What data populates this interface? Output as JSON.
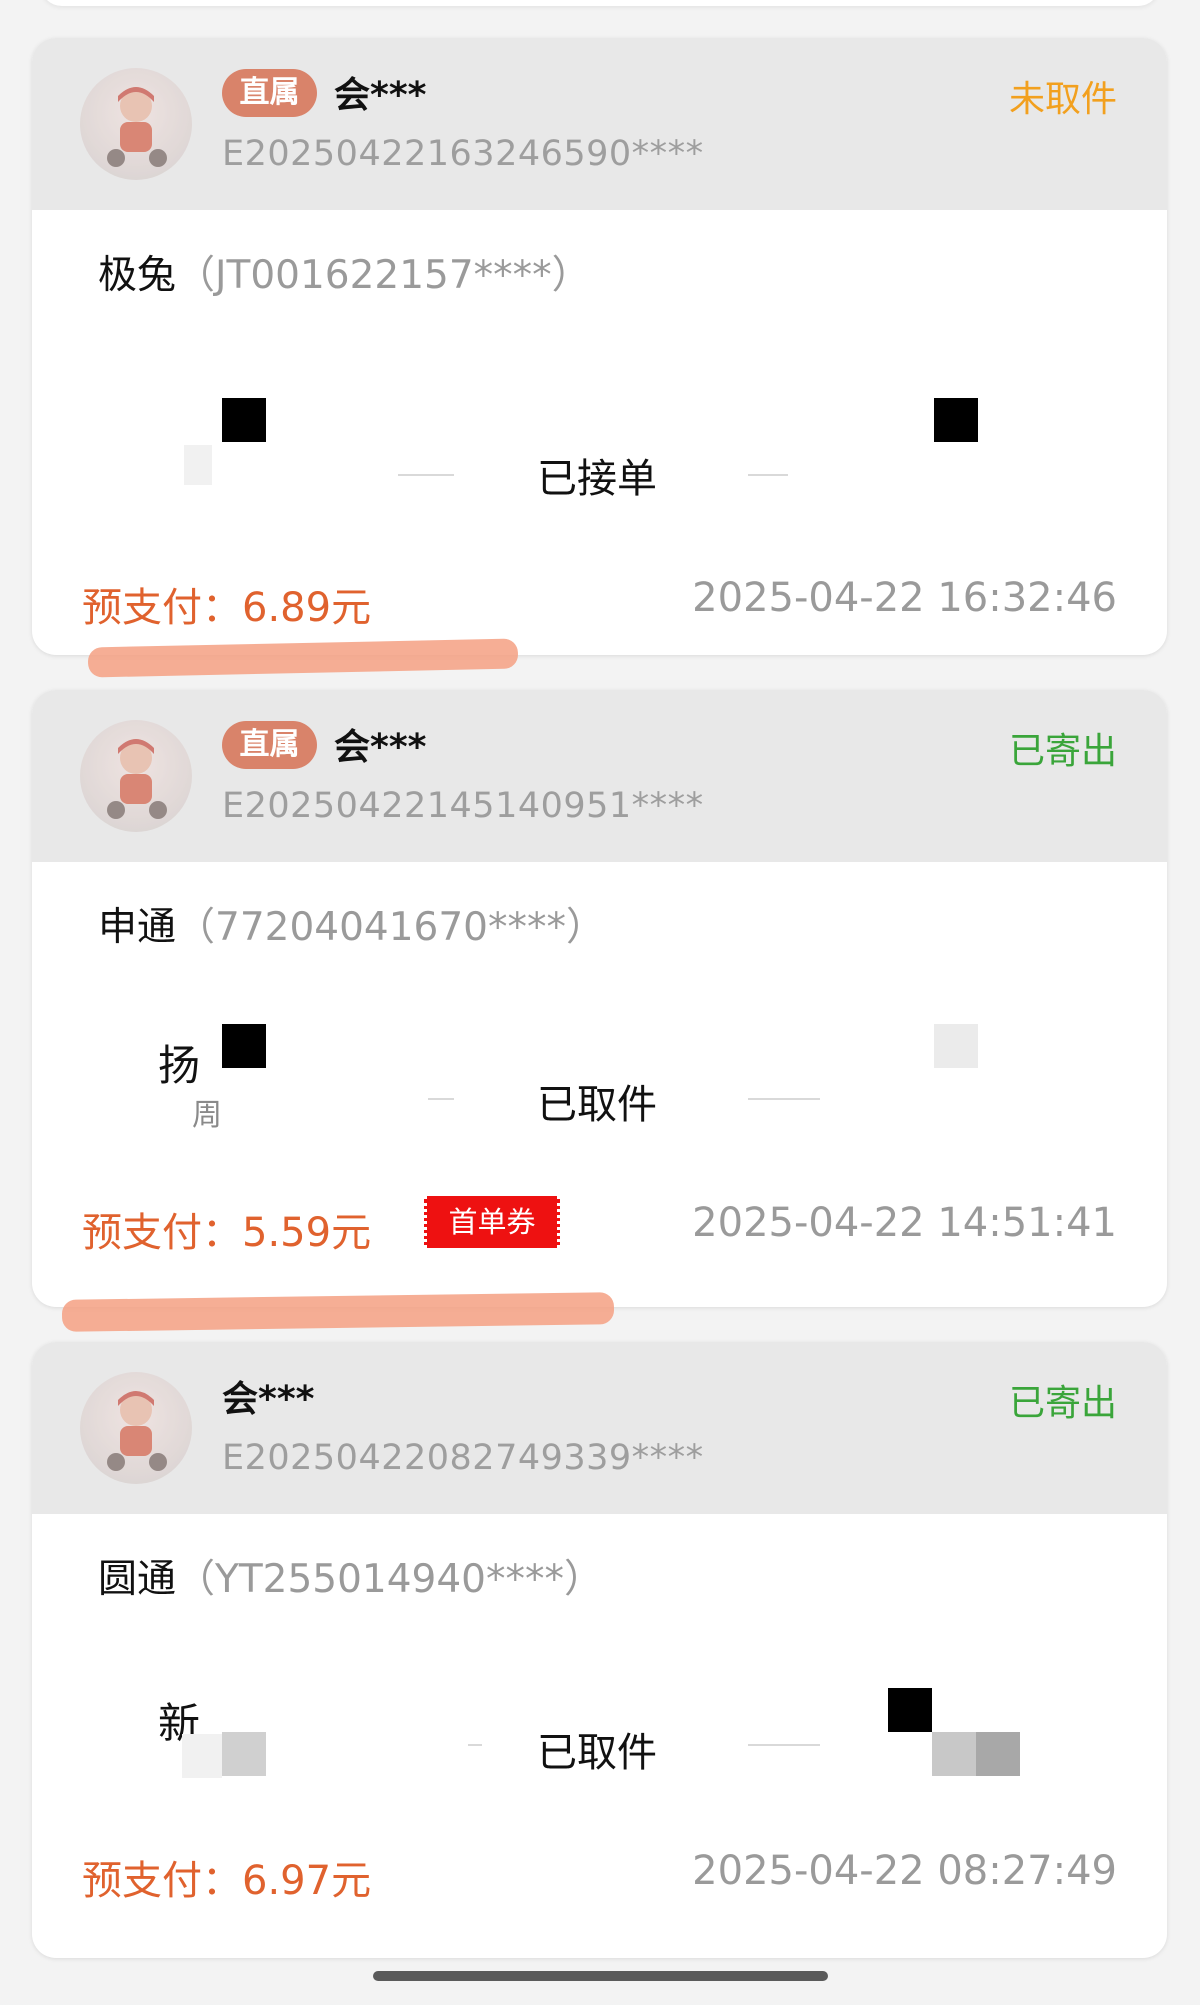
{
  "colors": {
    "status_pending": "#f2a01e",
    "status_shipped": "#3aa53a",
    "prepay": "#e0622e",
    "badge": "#d9836a",
    "coupon": "#ee1111",
    "highlight": "#f4a082"
  },
  "orders": [
    {
      "badge": "直属",
      "user": "会***",
      "order_id": "E20250422163246590****",
      "status": "未取件",
      "status_color": "#f2a01e",
      "carrier": "极兔",
      "tracking": "（JT001622157****）",
      "progress": "已接单",
      "prepay_label": "预支付：",
      "prepay_amount": "6.89元",
      "datetime": "2025-04-22 16:32:46"
    },
    {
      "badge": "直属",
      "user": "会***",
      "order_id": "E20250422145140951****",
      "status": "已寄出",
      "status_color": "#3aa53a",
      "carrier": "申通",
      "tracking": "（77204041670****）",
      "origin_char": "扬",
      "origin_sub": "周",
      "progress": "已取件",
      "prepay_label": "预支付：",
      "prepay_amount": "5.59元",
      "coupon": "首单券",
      "datetime": "2025-04-22 14:51:41"
    },
    {
      "user": "会***",
      "order_id": "E20250422082749339****",
      "status": "已寄出",
      "status_color": "#3aa53a",
      "carrier": "圆通",
      "tracking": "（YT255014940****）",
      "origin_char": "新",
      "progress": "已取件",
      "prepay_label": "预支付：",
      "prepay_amount": "6.97元",
      "datetime": "2025-04-22 08:27:49"
    }
  ]
}
